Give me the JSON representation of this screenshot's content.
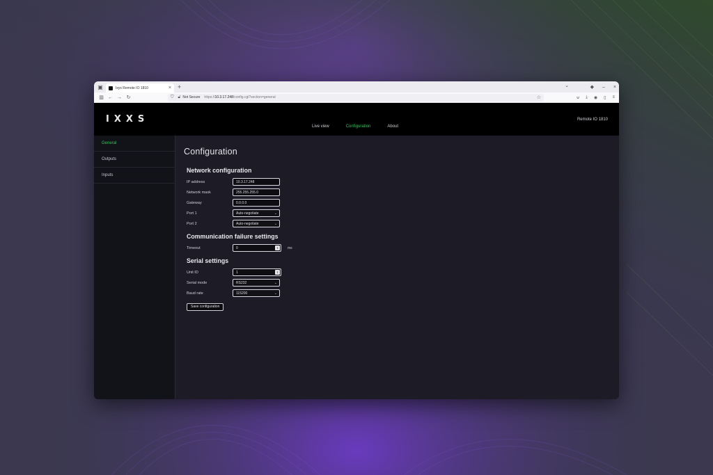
{
  "browser": {
    "tab_title": "Ixys Remote IO 1810",
    "url_not_secure": "Not Secure",
    "url_prefix": "https://",
    "url_host": "10.3.17.248",
    "url_path": "/config.cgi?section=general"
  },
  "app": {
    "logo": "IXXS",
    "device_name": "Remote IO 1810",
    "nav": [
      "Live view",
      "Configuration",
      "About"
    ],
    "sidebar": [
      "General",
      "Outputs",
      "Inputs"
    ]
  },
  "content": {
    "page_title": "Configuration",
    "network": {
      "title": "Network configuration",
      "ip_label": "IP address",
      "ip_value": "10.3.17.248",
      "mask_label": "Network mask",
      "mask_value": "255.255.255.0",
      "gateway_label": "Gateway",
      "gateway_value": "0.0.0.0",
      "port1_label": "Port 1",
      "port1_value": "Auto-negotiate",
      "port2_label": "Port 2",
      "port2_value": "Auto-negotiate"
    },
    "comm": {
      "title": "Communication failure settings",
      "timeout_label": "Timeout",
      "timeout_value": "0",
      "timeout_unit": "ms"
    },
    "serial": {
      "title": "Serial settings",
      "unit_label": "Unit ID",
      "unit_value": "1",
      "mode_label": "Serial mode",
      "mode_value": "RS232",
      "baud_label": "Baud rate",
      "baud_value": "115200"
    },
    "save_label": "Save configuration"
  },
  "colors": {
    "accent": "#34c759",
    "header_bg": "#000000",
    "content_bg": "#1c1b26"
  }
}
